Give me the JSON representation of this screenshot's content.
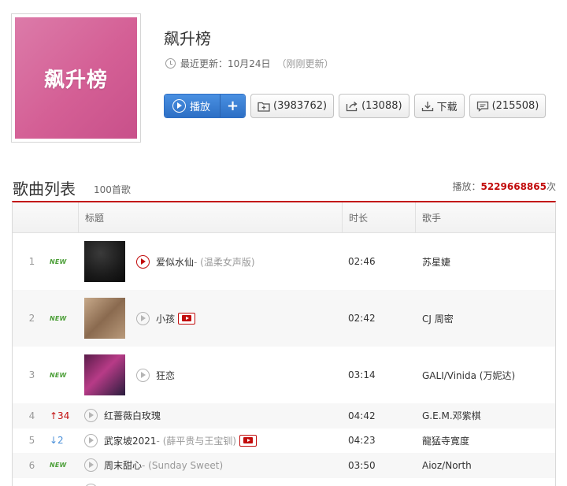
{
  "playlist": {
    "cover_text": "飙升榜",
    "title": "飙升榜",
    "update_label": "最近更新：10月24日",
    "update_note": "（刚刚更新）"
  },
  "actions": {
    "play": "播放",
    "add": "+",
    "collect": "(3983762)",
    "share": "(13088)",
    "download": "下载",
    "comment": "(215508)"
  },
  "songlist": {
    "heading": "歌曲列表",
    "count": "100首歌",
    "play_label": "播放：",
    "play_count": "5229668865",
    "play_suffix": "次",
    "columns": {
      "title": "标题",
      "duration": "时长",
      "artist": "歌手"
    }
  },
  "songs": [
    {
      "index": "1",
      "rank": "NEW",
      "title": "爱似水仙",
      "subtitle": " - (温柔女声版)",
      "duration": "02:46",
      "artist": "苏星婕"
    },
    {
      "index": "2",
      "rank": "NEW",
      "title": "小孩",
      "subtitle": "",
      "duration": "02:42",
      "artist": "CJ 周密"
    },
    {
      "index": "3",
      "rank": "NEW",
      "title": "狂恋",
      "subtitle": "",
      "duration": "03:14",
      "artist": "GALI/Vinida (万妮达)"
    },
    {
      "index": "4",
      "rank": "↑34",
      "title": "红蔷薇白玫瑰",
      "subtitle": "",
      "duration": "04:42",
      "artist": "G.E.M.邓紫棋"
    },
    {
      "index": "5",
      "rank": "↓2",
      "title": "武家坡2021",
      "subtitle": " - (薛平贵与王宝钏)",
      "duration": "04:23",
      "artist": "龍猛寺寛度"
    },
    {
      "index": "6",
      "rank": "NEW",
      "title": "周末甜心",
      "subtitle": " - (Sunday Sweet)",
      "duration": "03:50",
      "artist": "Aioz/North"
    }
  ]
}
